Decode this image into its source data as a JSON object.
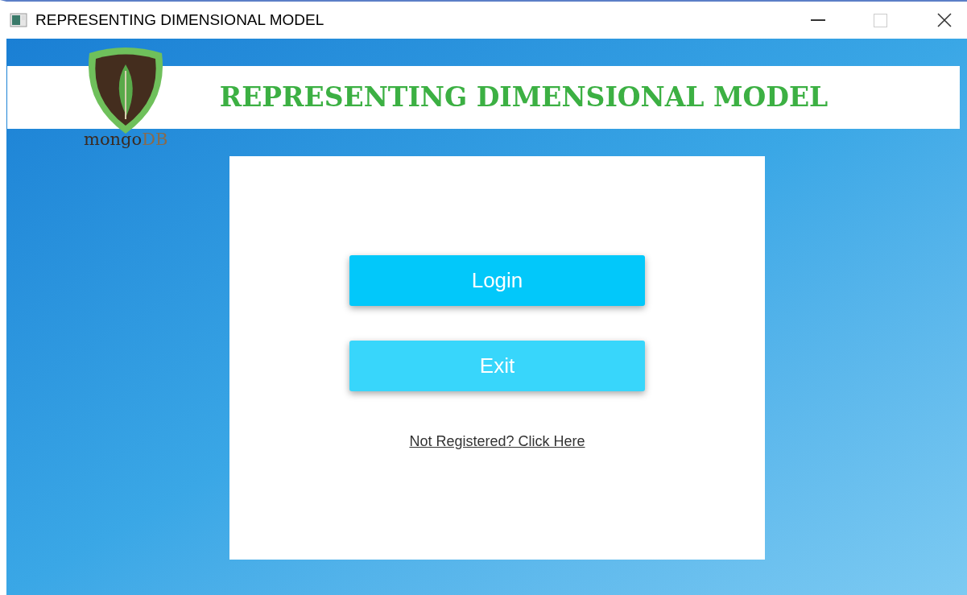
{
  "window": {
    "title": "REPRESENTING DIMENSIONAL MODEL",
    "maximize_enabled": false
  },
  "logo": {
    "wordmark": [
      "mongo",
      "DB"
    ]
  },
  "banner": {
    "title": "REPRESENTING DIMENSIONAL MODEL"
  },
  "buttons": [
    {
      "label": "Login",
      "kind": "primary"
    },
    {
      "label": "Exit",
      "kind": "secondary"
    }
  ],
  "link": "Not Registered? Click Here"
}
